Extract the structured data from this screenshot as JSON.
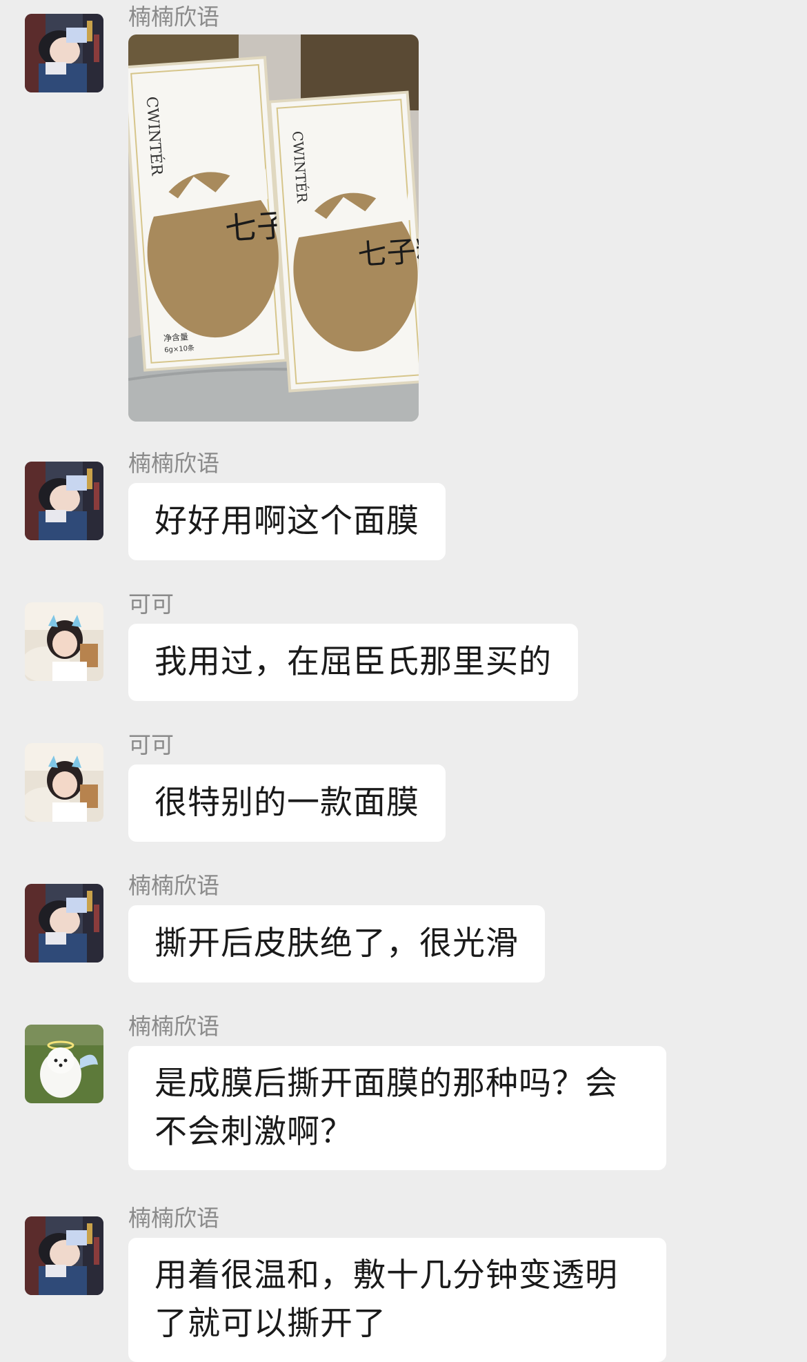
{
  "messages": [
    {
      "sender": "楠楠欣语",
      "kind": "image",
      "box_brand": "CWINTÉR",
      "box_product": "七子粉",
      "box_net_label": "净含量",
      "box_net_value": "6g×10条"
    },
    {
      "sender": "楠楠欣语",
      "kind": "text",
      "text": "好好用啊这个面膜"
    },
    {
      "sender": "可可",
      "kind": "text",
      "text": "我用过，在屈臣氏那里买的"
    },
    {
      "sender": "可可",
      "kind": "text",
      "text": "很特别的一款面膜"
    },
    {
      "sender": "楠楠欣语",
      "kind": "text",
      "text": "撕开后皮肤绝了，很光滑"
    },
    {
      "sender": "楠楠欣语",
      "kind": "text",
      "text": "是成膜后撕开面膜的那种吗？会不会刺激啊？"
    },
    {
      "sender": "楠楠欣语",
      "kind": "text",
      "text": "用着很温和，敷十几分钟变透明了就可以撕开了"
    }
  ],
  "colors": {
    "background": "#ededed",
    "bubble": "#ffffff",
    "sender_name": "#8a8a8a",
    "message_text": "#1a1a1a",
    "egg_gold": "#a88a5c"
  },
  "avatars": [
    "girl-lying-avatar",
    "girl-lying-avatar",
    "girl-cat-ears-avatar",
    "girl-cat-ears-avatar",
    "girl-lying-avatar",
    "white-dog-avatar",
    "girl-lying-avatar"
  ]
}
